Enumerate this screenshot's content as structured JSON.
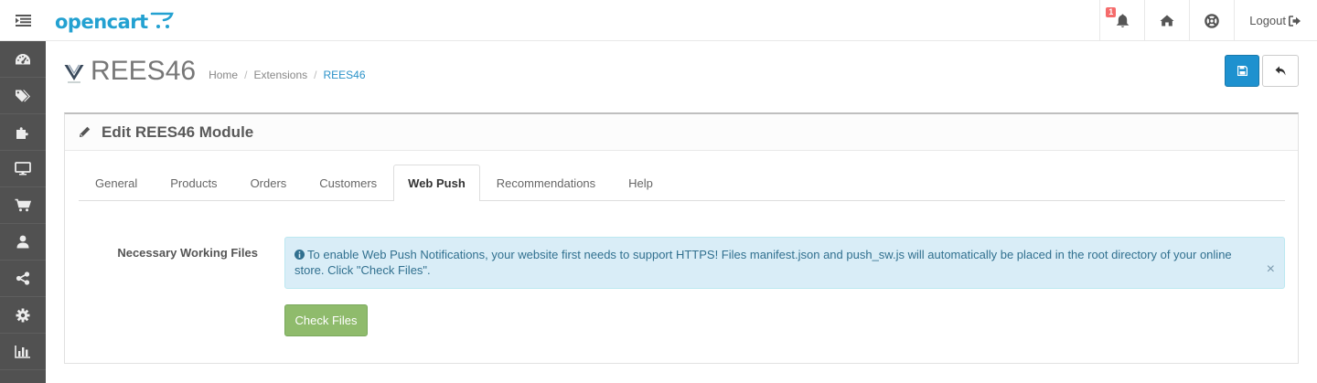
{
  "header": {
    "logo_text": "opencart",
    "notification_count": "1",
    "logout_label": "Logout"
  },
  "sidebar": {
    "items": [
      {
        "icon": "dashboard-icon"
      },
      {
        "icon": "tags-icon"
      },
      {
        "icon": "puzzle-icon"
      },
      {
        "icon": "desktop-icon"
      },
      {
        "icon": "shopping-cart-icon"
      },
      {
        "icon": "user-icon"
      },
      {
        "icon": "share-icon"
      },
      {
        "icon": "gear-icon"
      },
      {
        "icon": "bar-chart-icon"
      }
    ]
  },
  "page": {
    "title": "REES46",
    "breadcrumb": [
      "Home",
      "Extensions",
      "REES46"
    ]
  },
  "panel": {
    "title": "Edit REES46 Module",
    "tabs": [
      "General",
      "Products",
      "Orders",
      "Customers",
      "Web Push",
      "Recommendations",
      "Help"
    ],
    "active_tab": "Web Push",
    "field_label": "Necessary Working Files",
    "alert_text": "To enable Web Push Notifications, your website first needs to support HTTPS! Files manifest.json and push_sw.js will automatically be placed in the root directory of your online store. Click \"Check Files\".",
    "alert_close": "×",
    "check_button": "Check Files"
  },
  "colors": {
    "primary": "#1e91cf",
    "success": "#8fbb6c",
    "sidebar": "#515151",
    "alert_bg": "#d9edf7",
    "badge": "#f56b6b"
  }
}
